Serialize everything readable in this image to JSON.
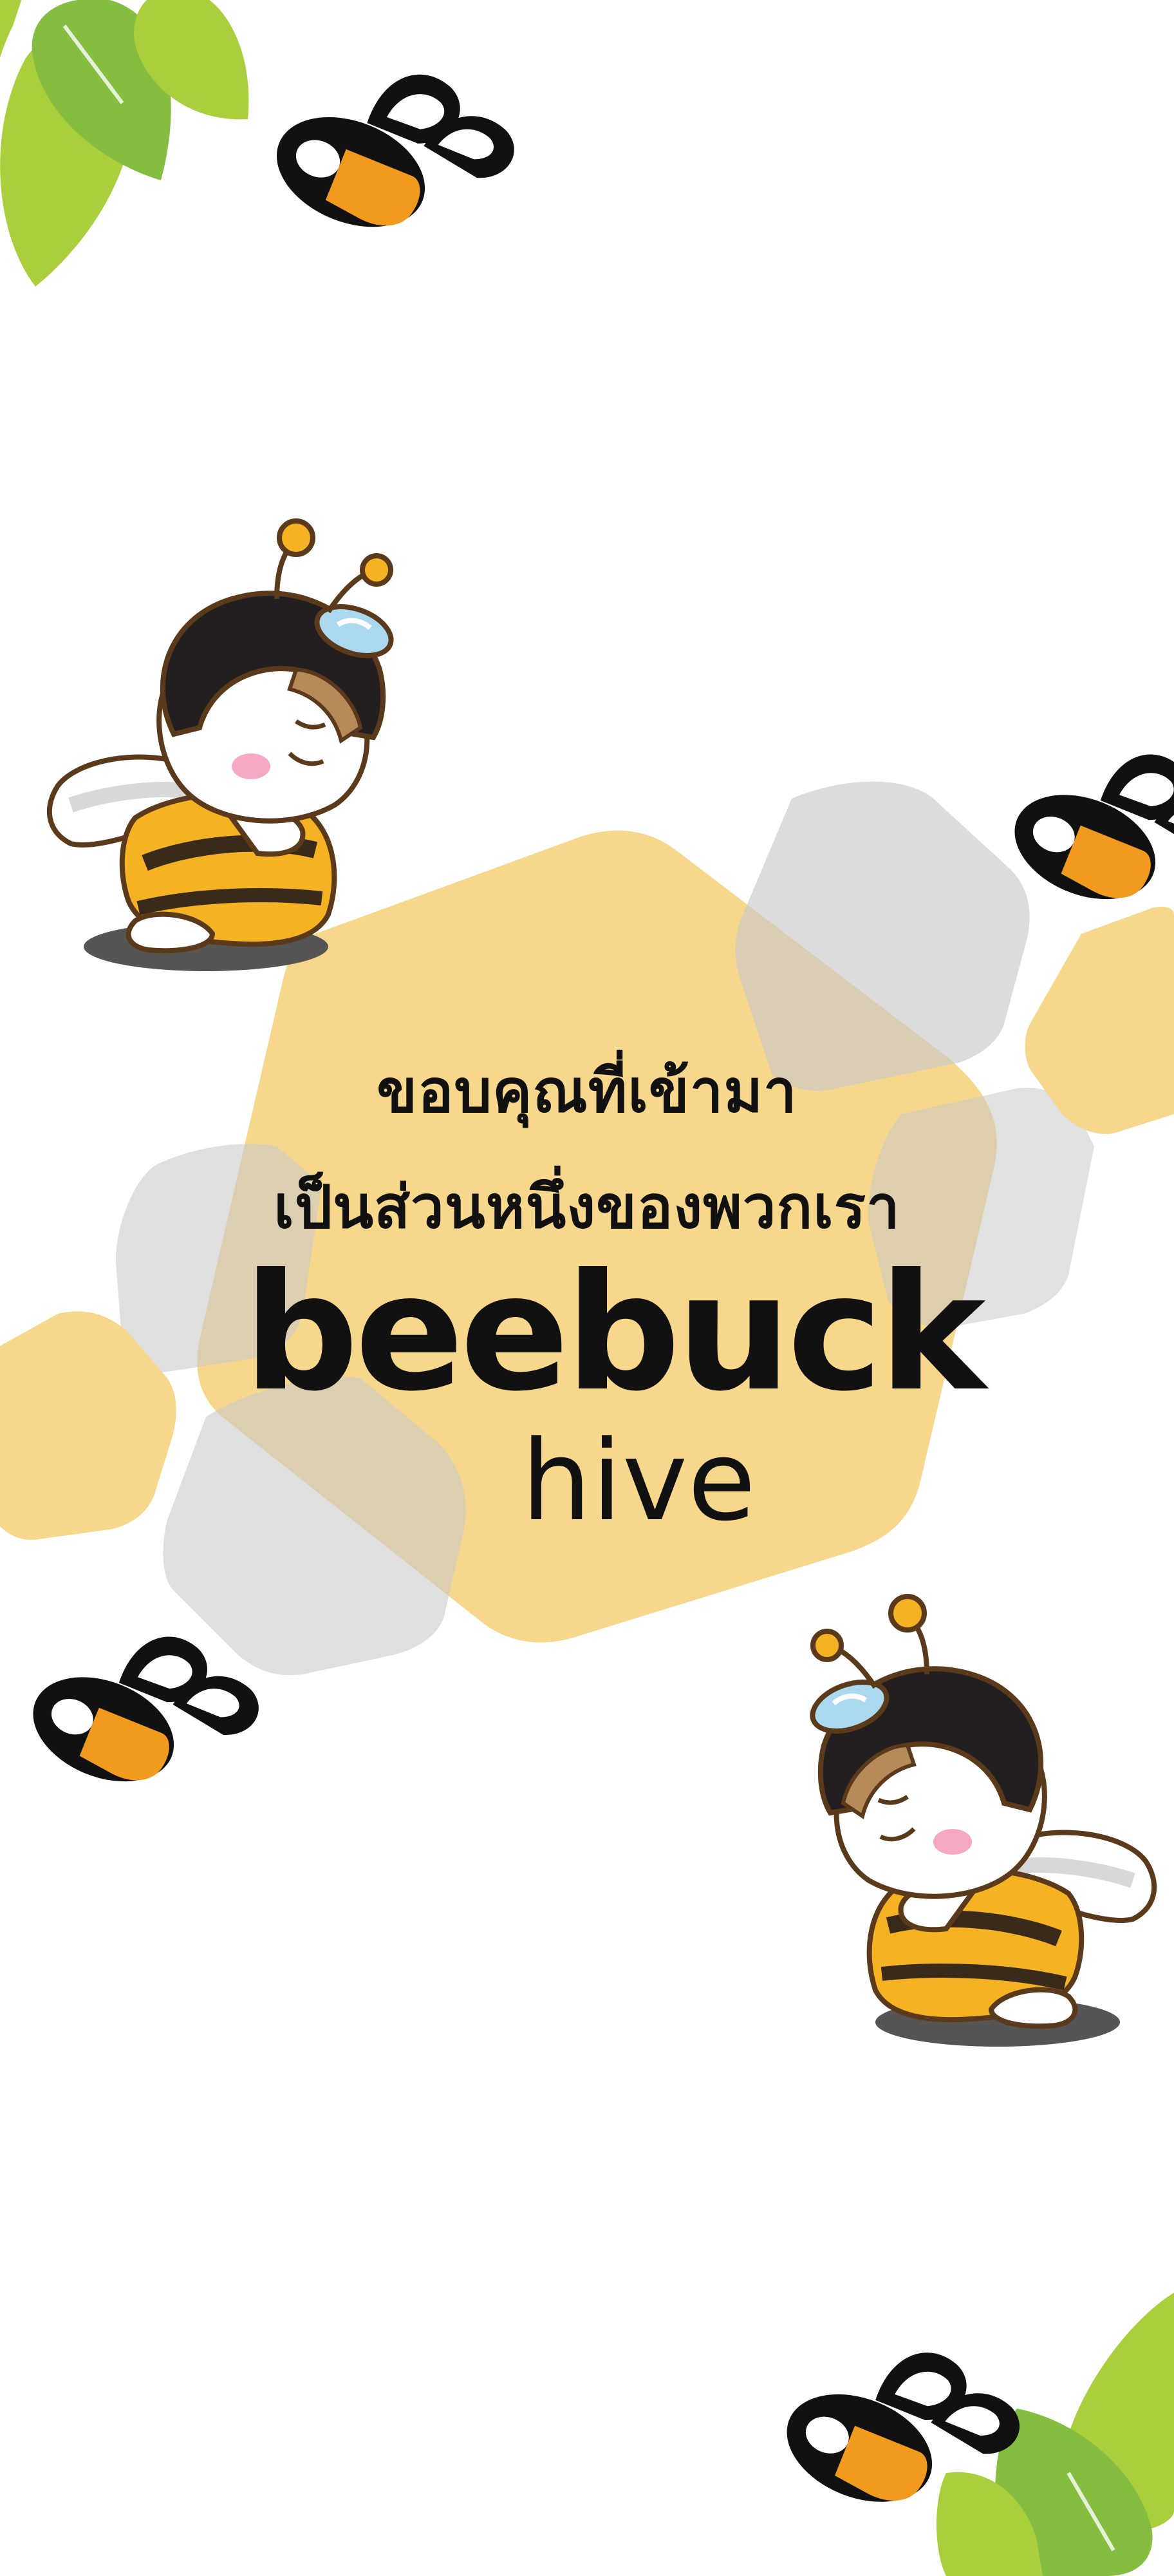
{
  "message": {
    "line1": "ขอบคุณที่เข้ามา",
    "line2": "เป็นส่วนหนึ่งของพวกเรา"
  },
  "brand": {
    "name": "beebuck",
    "sub": "hive"
  },
  "colors": {
    "honey": "#f7d78c",
    "hex_gray": "#c9c9c9",
    "bee_yellow": "#f5b222",
    "bee_orange": "#f29a1e",
    "leaf_light": "#a9cf3c",
    "leaf_dark": "#84bd3f",
    "black": "#111111"
  },
  "decorations": {
    "logo_mark": "bee-logo-mark-icon",
    "mascot": "bee-mascot-bowing-icon",
    "leaves": "leaf-cluster-icon",
    "honeycomb": "honeycomb-hexagon-shape"
  }
}
